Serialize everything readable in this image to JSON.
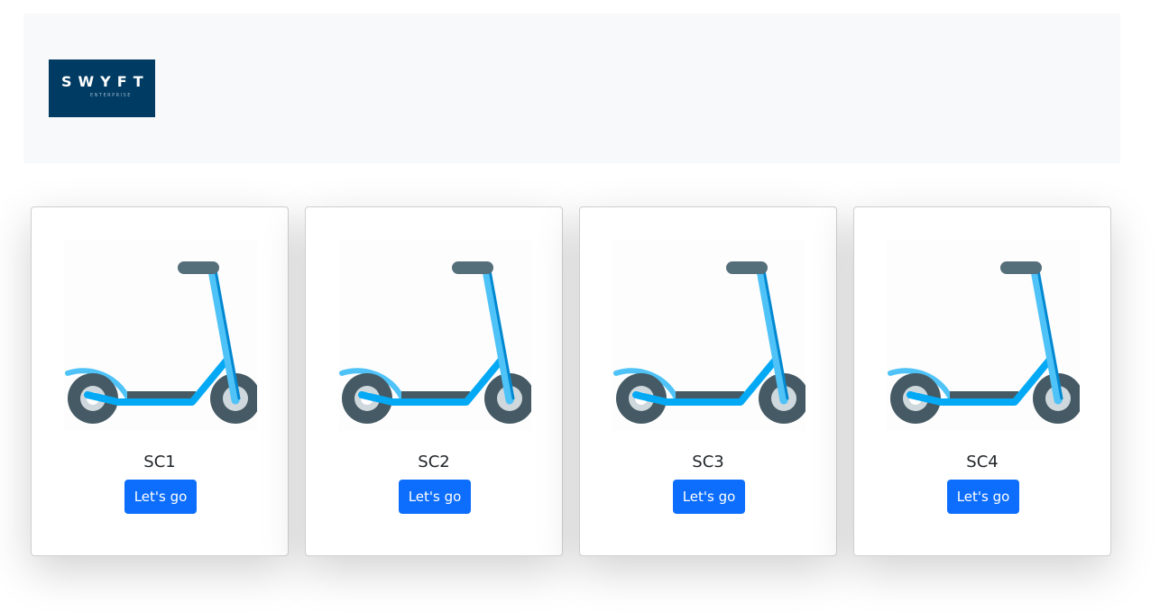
{
  "header": {
    "logo_text": "SWYFT",
    "logo_subtext": "ENTERPRISE"
  },
  "colors": {
    "header_bg": "#f8f9fa",
    "logo_bg": "#003b63",
    "button_bg": "#0d6efd",
    "scooter_stem": "#29b6f6",
    "scooter_deck": "#03a9f4",
    "wheel": "#455a64"
  },
  "cards": [
    {
      "title": "SC1",
      "button_label": "Let's go",
      "icon": "scooter-icon"
    },
    {
      "title": "SC2",
      "button_label": "Let's go",
      "icon": "scooter-icon"
    },
    {
      "title": "SC3",
      "button_label": "Let's go",
      "icon": "scooter-icon"
    },
    {
      "title": "SC4",
      "button_label": "Let's go",
      "icon": "scooter-icon"
    }
  ]
}
